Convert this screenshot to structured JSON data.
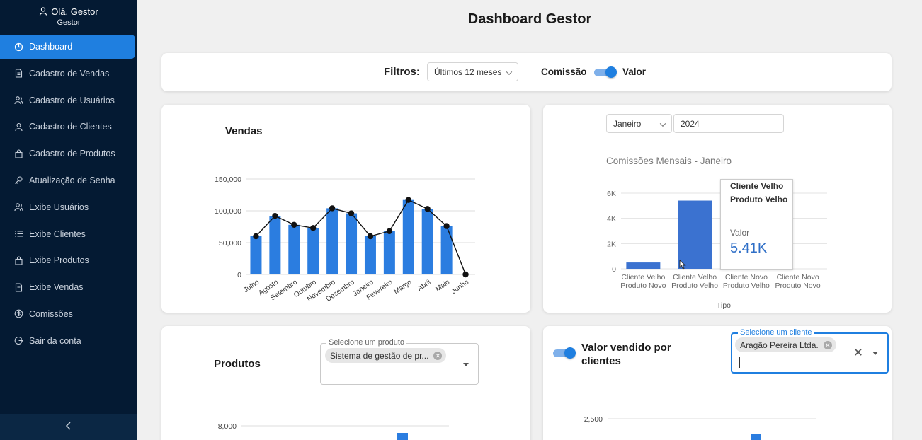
{
  "sidebar": {
    "greeting": "Olá, Gestor",
    "role": "Gestor",
    "items": [
      {
        "label": "Dashboard",
        "icon": "pie-chart-icon",
        "active": true
      },
      {
        "label": "Cadastro de Vendas",
        "icon": "document-icon"
      },
      {
        "label": "Cadastro de Usuários",
        "icon": "users-icon"
      },
      {
        "label": "Cadastro de Clientes",
        "icon": "user-icon"
      },
      {
        "label": "Cadastro de Produtos",
        "icon": "bag-icon"
      },
      {
        "label": "Atualização de Senha",
        "icon": "key-icon"
      },
      {
        "label": "Exibe Usuários",
        "icon": "users-icon"
      },
      {
        "label": "Exibe Clientes",
        "icon": "list-icon"
      },
      {
        "label": "Exibe Produtos",
        "icon": "bag-icon"
      },
      {
        "label": "Exibe Vendas",
        "icon": "document-icon"
      },
      {
        "label": "Comissões",
        "icon": "dollar-icon"
      },
      {
        "label": "Sair da conta",
        "icon": "logout-icon"
      }
    ],
    "collapse_icon": "chevron-left-icon"
  },
  "page": {
    "title": "Dashboard Gestor"
  },
  "filters": {
    "label": "Filtros:",
    "period": "Últimos 12 meses",
    "comissao_label": "Comissão",
    "valor_label": "Valor",
    "toggle_on": true
  },
  "vendas": {
    "title": "Vendas"
  },
  "comissoes": {
    "month": "Janeiro",
    "year": "2024",
    "title": "Comissões Mensais - Janeiro",
    "tooltip": {
      "name_line1": "Cliente Velho",
      "name_line2": "Produto Velho",
      "label": "Valor",
      "value": "5.41K"
    }
  },
  "produtos": {
    "title": "Produtos",
    "select_label": "Selecione um produto",
    "chip": "Sistema de gestão de pr...",
    "axis_tick": "8,000"
  },
  "clientes": {
    "title": "Valor vendido por clientes",
    "select_label": "Selecione um cliente",
    "chip": "Aragão Pereira Ltda.",
    "axis_tick": "2,500",
    "toggle_on": true
  },
  "chart_data": [
    {
      "type": "bar",
      "title": "Vendas",
      "categories": [
        "Julho",
        "Agosto",
        "Setembro",
        "Outubro",
        "Novembro",
        "Dezembro",
        "Janeiro",
        "Fevereiro",
        "Março",
        "Abril",
        "Maio",
        "Junho"
      ],
      "series": [
        {
          "type": "bar",
          "values": [
            60000,
            92000,
            78000,
            73000,
            104000,
            96000,
            60000,
            68000,
            117000,
            103000,
            76000,
            0
          ]
        },
        {
          "type": "line",
          "values": [
            60000,
            92000,
            78000,
            73000,
            104000,
            96000,
            60000,
            68000,
            117000,
            103000,
            76000,
            0
          ]
        }
      ],
      "yticks": [
        "150,000",
        "100,000",
        "50,000",
        "0"
      ],
      "ylim": [
        0,
        150000
      ],
      "color": "#2b7de0"
    },
    {
      "type": "bar",
      "title": "Comissões Mensais - Janeiro",
      "categories": [
        [
          "Cliente Velho",
          "Produto Novo"
        ],
        [
          "Cliente Velho",
          "Produto Velho"
        ],
        [
          "Cliente Novo",
          "Produto Velho"
        ],
        [
          "Cliente Novo",
          "Produto Novo"
        ]
      ],
      "values": [
        500,
        5410,
        0,
        0
      ],
      "xlabel": "Tipo",
      "yticks": [
        "6K",
        "4K",
        "2K",
        "0"
      ],
      "ylim": [
        0,
        6000
      ],
      "color": "#3b72d0"
    }
  ]
}
